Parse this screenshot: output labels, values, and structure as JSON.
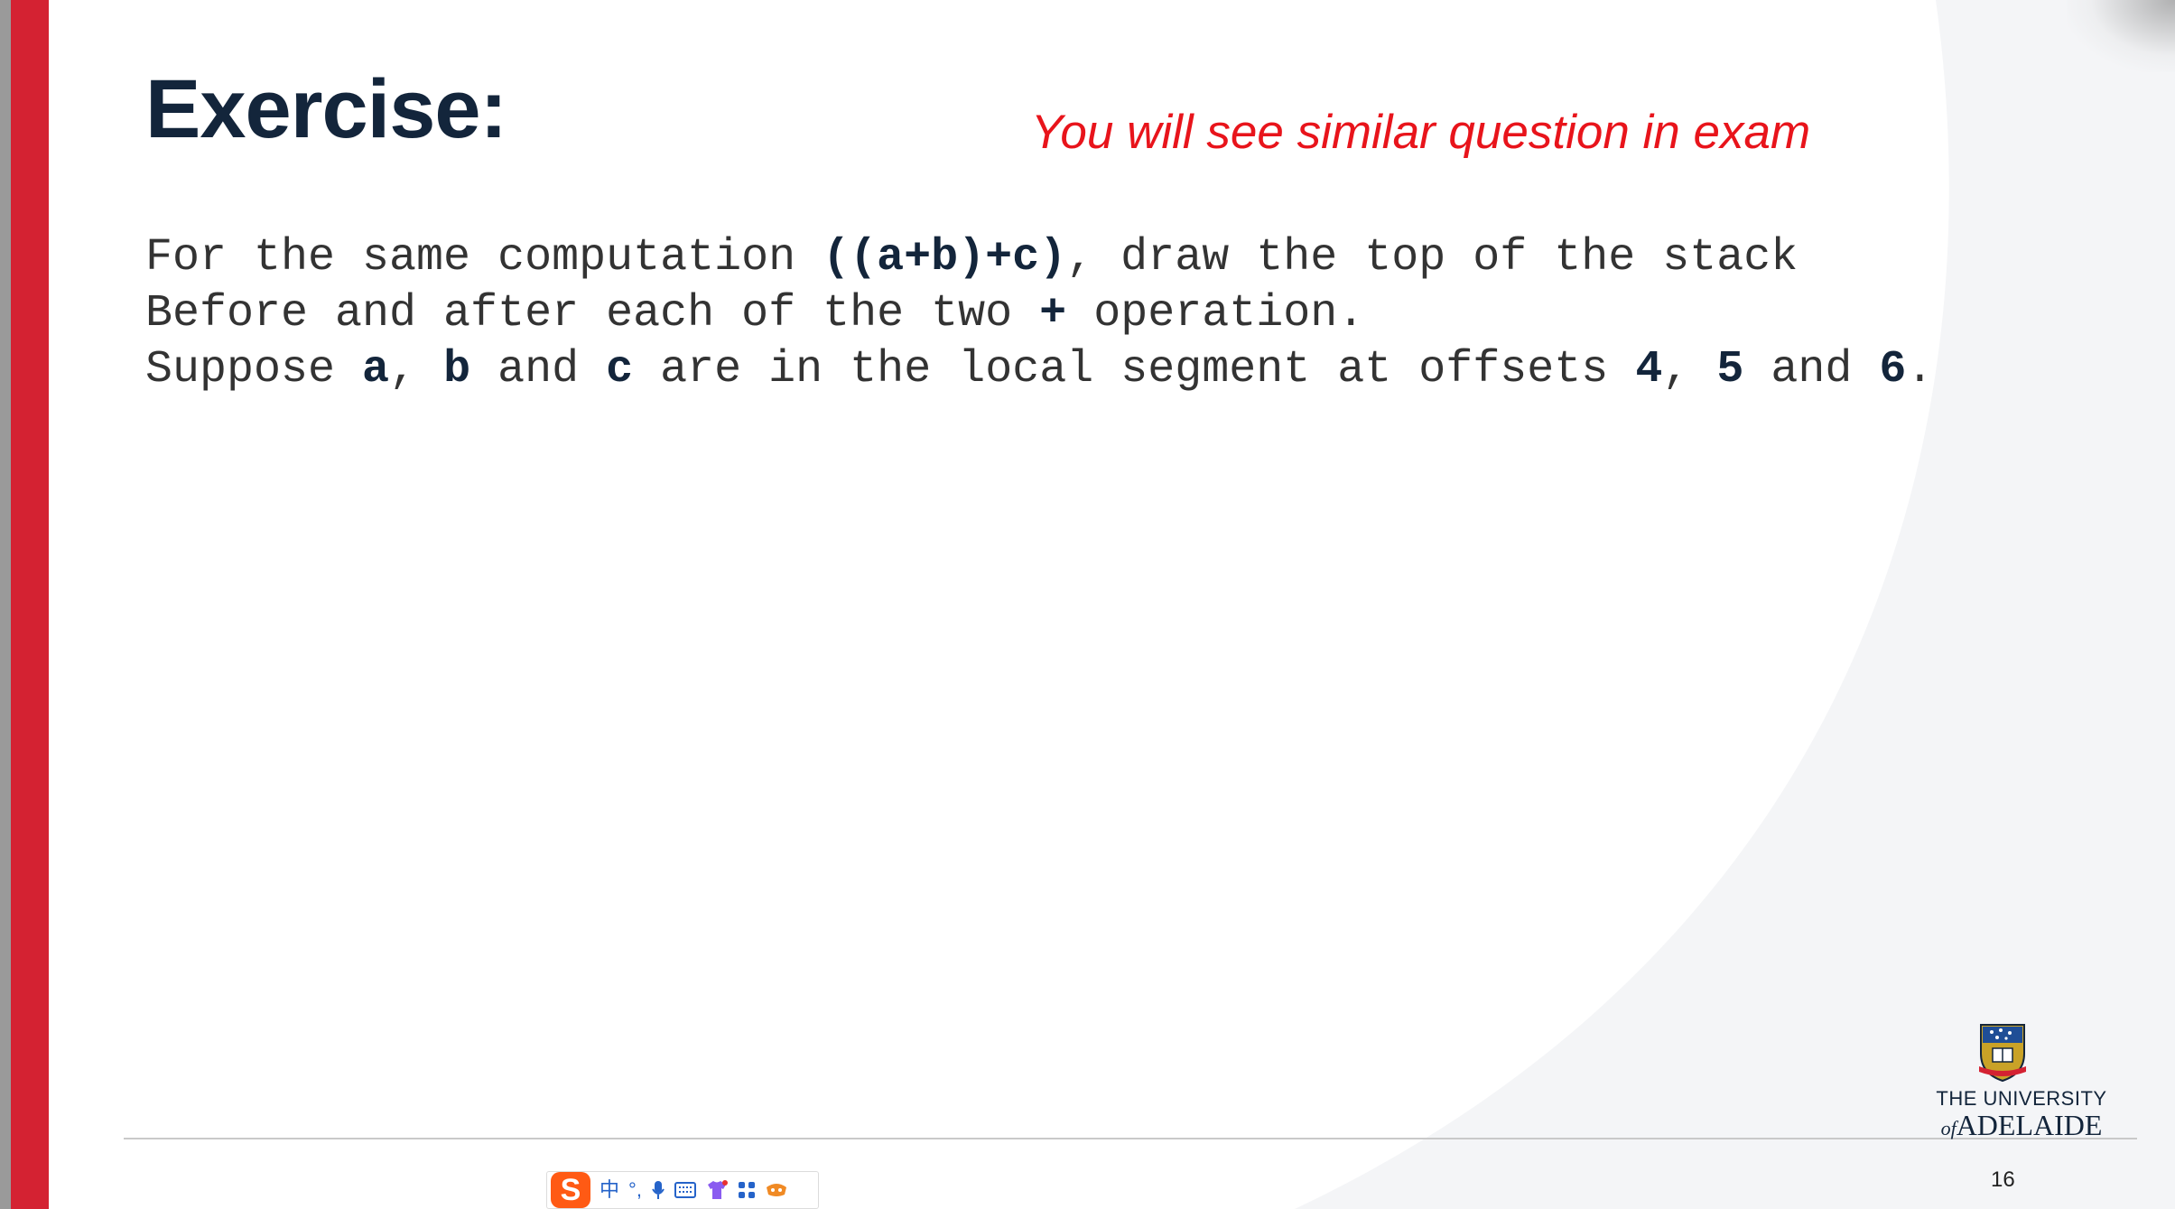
{
  "slide": {
    "title": "Exercise:",
    "note": "You will see similar question in exam",
    "body": {
      "line1": {
        "p1": "For the same computation ",
        "b1": "((a+b)+c)",
        "p2": ", draw the top of the stack"
      },
      "line2": {
        "p1": "Before and after each of the two ",
        "b1": "+",
        "p2": " operation."
      },
      "line3": {
        "p1": "Suppose ",
        "b1": "a",
        "p2": ", ",
        "b2": "b",
        "p3": " and ",
        "b3": "c",
        "p4": " are in the local segment at offsets ",
        "b4": "4",
        "p5": ", ",
        "b5": "5",
        "p6": " and ",
        "b6": "6",
        "p7": "."
      }
    },
    "logo": {
      "line1": "THE UNIVERSITY",
      "line2_of": "of",
      "line2_name": "ADELAIDE"
    },
    "page_number": "16"
  },
  "ime_toolbar": {
    "logo_letter": "S",
    "mode": "中",
    "punct": "°,",
    "icons": [
      "microphone-icon",
      "keyboard-icon",
      "shirt-icon",
      "apps-grid-icon",
      "game-icon"
    ]
  },
  "colors": {
    "accent_red": "#d42232",
    "title_navy": "#13253b",
    "note_red": "#e8141b"
  }
}
